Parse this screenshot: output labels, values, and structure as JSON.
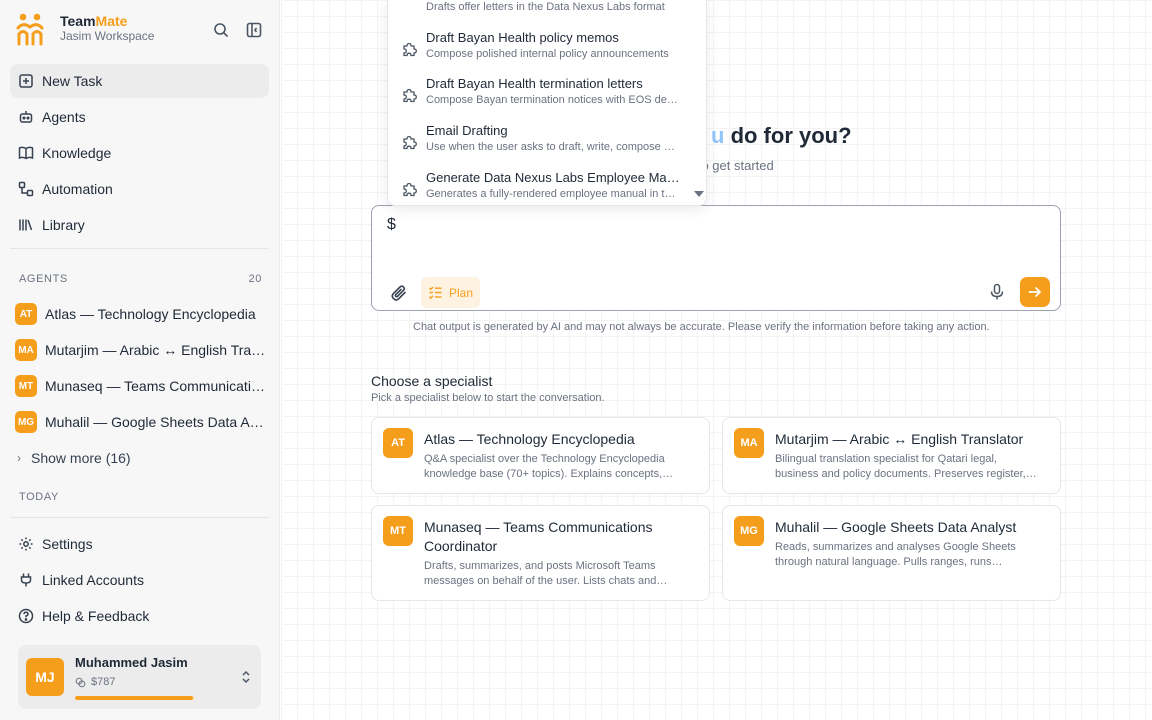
{
  "brand": {
    "name_a": "Team",
    "name_b": "Mate",
    "workspace": "Jasim Workspace"
  },
  "nav": [
    {
      "label": "New Task",
      "icon": "plus-square-icon"
    },
    {
      "label": "Agents",
      "icon": "robot-icon"
    },
    {
      "label": "Knowledge",
      "icon": "book-icon"
    },
    {
      "label": "Automation",
      "icon": "workflow-icon"
    },
    {
      "label": "Library",
      "icon": "library-icon"
    }
  ],
  "agents_section": {
    "label": "AGENTS",
    "count": "20"
  },
  "agents": [
    {
      "initials": "AT",
      "name": "Atlas — Technology Encyclopedia"
    },
    {
      "initials": "MA",
      "name": "Mutarjim — Arabic ↔ English Translator"
    },
    {
      "initials": "MT",
      "name": "Munaseq — Teams Communications Coordinator"
    },
    {
      "initials": "MG",
      "name": "Muhalil — Google Sheets Data Analyst"
    }
  ],
  "show_more": "Show more (16)",
  "today_label": "TODAY",
  "bottom_nav": [
    {
      "label": "Settings",
      "icon": "gear-icon"
    },
    {
      "label": "Linked Accounts",
      "icon": "plug-icon"
    },
    {
      "label": "Help & Feedback",
      "icon": "help-icon"
    }
  ],
  "user": {
    "initials": "MJ",
    "name": "Muhammed Jasim",
    "credits": "$787",
    "credit_fraction": 0.98
  },
  "hero": {
    "title_accent": "u",
    "title_rest": " do for you?",
    "subtitle": "g to get started"
  },
  "composer": {
    "value": "$",
    "plan_label": "Plan"
  },
  "disclaimer": "Chat output is generated by AI and may not always be accurate. Please verify the information before taking any action.",
  "specialists": {
    "title": "Choose a specialist",
    "subtitle": "Pick a specialist below to start the conversation.",
    "cards": [
      {
        "initials": "AT",
        "title": "Atlas — Technology Encyclopedia",
        "desc": "Q&A specialist over the Technology Encyclopedia knowledge base (70+ topics). Explains concepts, compares technologies and more."
      },
      {
        "initials": "MA",
        "title": "Mutarjim — Arabic ↔ English Translator",
        "desc": "Bilingual translation specialist for Qatari legal, business and policy documents. Preserves register, tone and terminology."
      },
      {
        "initials": "MT",
        "title": "Munaseq — Teams Communications Coordinator",
        "desc": "Drafts, summarizes, and posts Microsoft Teams messages on behalf of the user. Lists chats and channels."
      },
      {
        "initials": "MG",
        "title": "Muhalil — Google Sheets Data Analyst",
        "desc": "Reads, summarizes and analyses Google Sheets through natural language. Pulls ranges, runs calculations."
      }
    ]
  },
  "dropdown": [
    {
      "title": "",
      "desc": "Drafts offer letters in the Data Nexus Labs format"
    },
    {
      "title": "Draft Bayan Health policy memos",
      "desc": "Compose polished internal policy announcements"
    },
    {
      "title": "Draft Bayan Health termination letters",
      "desc": "Compose Bayan termination notices with EOS details"
    },
    {
      "title": "Email Drafting",
      "desc": "Use when the user asks to draft, write, compose an email"
    },
    {
      "title": "Generate Data Nexus Labs Employee Manual",
      "desc": "Generates a fully-rendered employee manual in the house style"
    }
  ],
  "colors": {
    "accent": "#f59e1c",
    "accent_soft": "#fef3e2",
    "sidebar_bg": "#f7f7f7"
  }
}
